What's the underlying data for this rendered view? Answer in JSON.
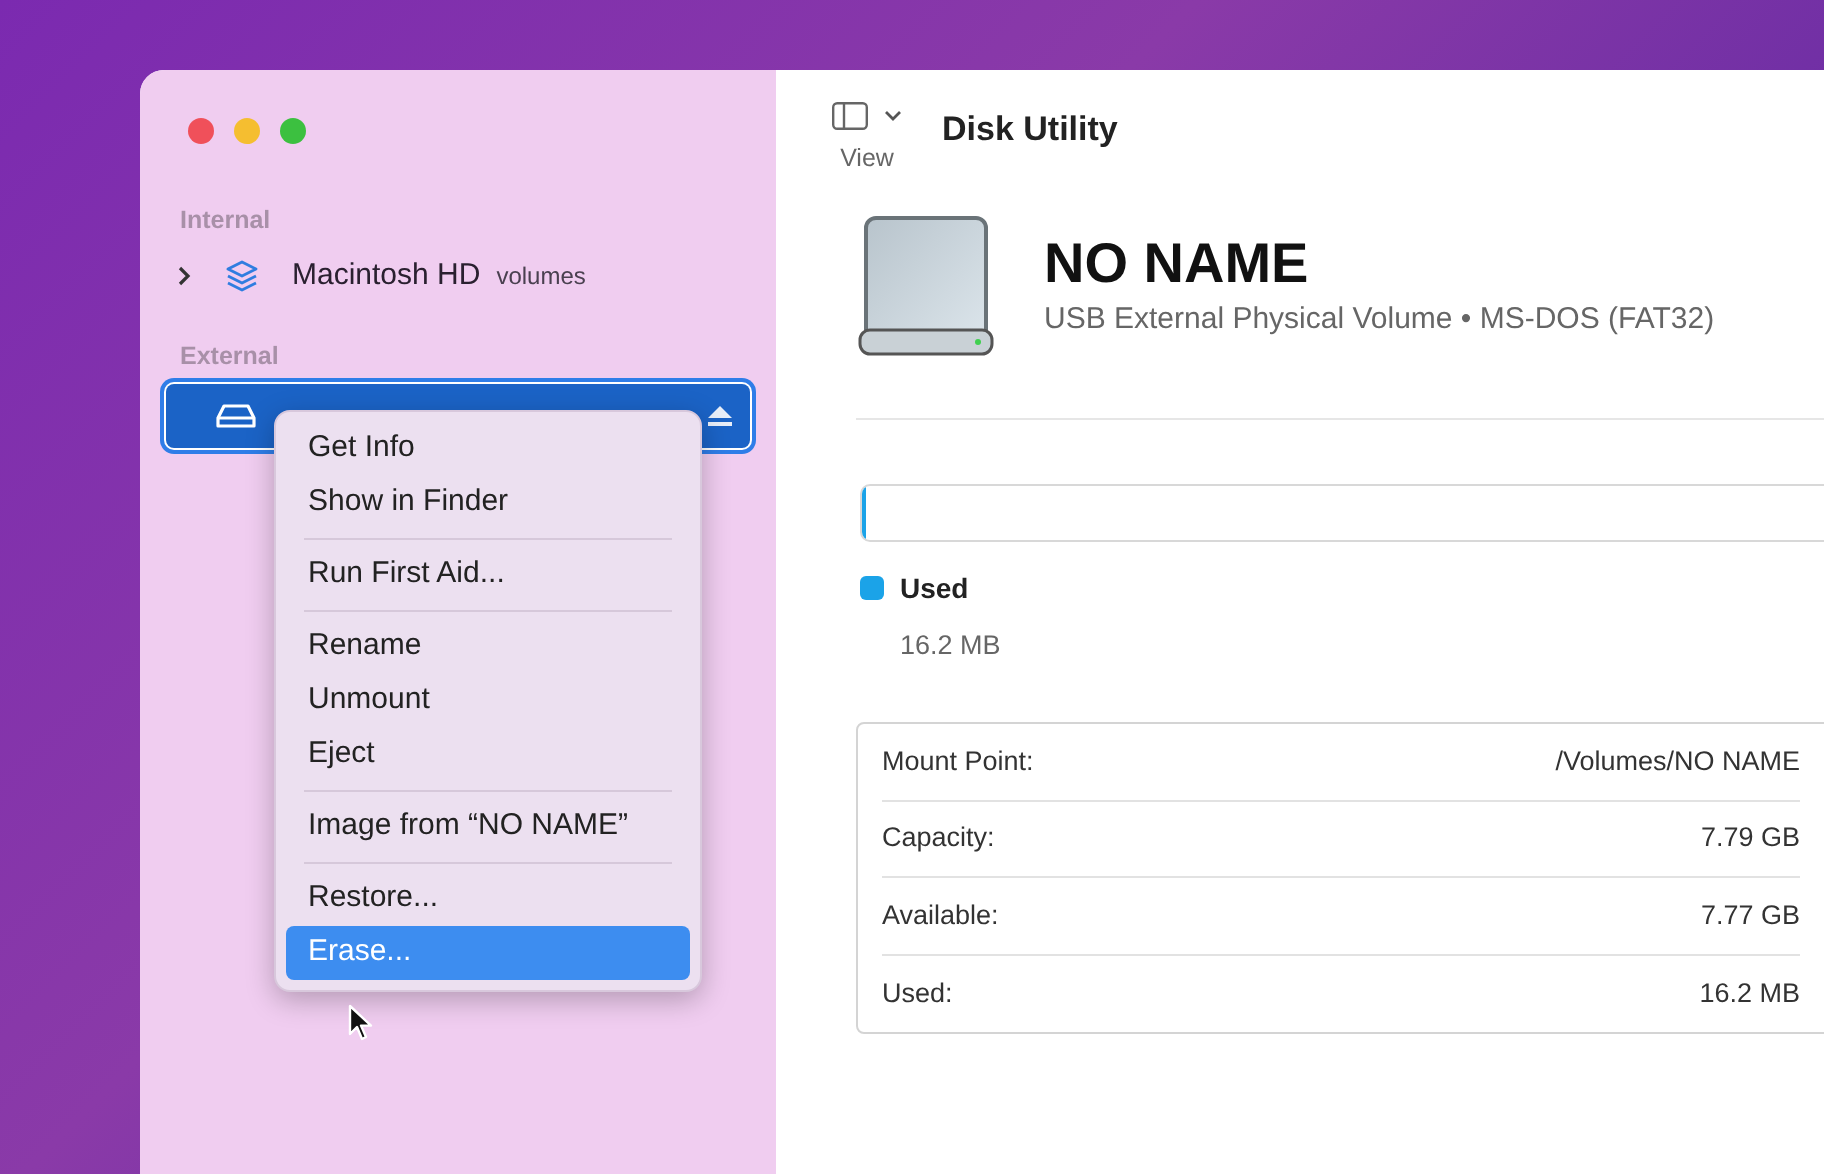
{
  "window": {
    "title": "Disk Utility"
  },
  "toolbar": {
    "view_label": "View"
  },
  "sidebar": {
    "sections": [
      {
        "heading": "Internal",
        "items": [
          {
            "name": "Macintosh HD",
            "detail": "volumes",
            "kind": "volumes",
            "selected": false,
            "expanded": false
          }
        ]
      },
      {
        "heading": "External",
        "items": [
          {
            "kind": "drive",
            "selected": true
          }
        ]
      }
    ]
  },
  "context_menu": {
    "groups": [
      [
        {
          "label": "Get Info",
          "selected": false
        },
        {
          "label": "Show in Finder",
          "selected": false
        }
      ],
      [
        {
          "label": "Run First Aid...",
          "selected": false
        }
      ],
      [
        {
          "label": "Rename",
          "selected": false
        },
        {
          "label": "Unmount",
          "selected": false
        },
        {
          "label": "Eject",
          "selected": false
        }
      ],
      [
        {
          "label": "Image from “NO NAME”",
          "selected": false
        }
      ],
      [
        {
          "label": "Restore...",
          "selected": false
        },
        {
          "label": "Erase...",
          "selected": true
        }
      ]
    ]
  },
  "volume": {
    "name": "NO NAME",
    "description": "USB External Physical Volume • MS-DOS (FAT32)"
  },
  "usage": {
    "level": 0.003,
    "legend": [
      {
        "label": "Used",
        "value": "16.2 MB",
        "color": "#1ba3e8"
      }
    ]
  },
  "info": [
    {
      "label": "Mount Point:",
      "value": "/Volumes/NO NAME"
    },
    {
      "label": "Capacity:",
      "value": "7.79 GB"
    },
    {
      "label": "Available:",
      "value": "7.77 GB"
    },
    {
      "label": "Used:",
      "value": "16.2 MB"
    }
  ]
}
